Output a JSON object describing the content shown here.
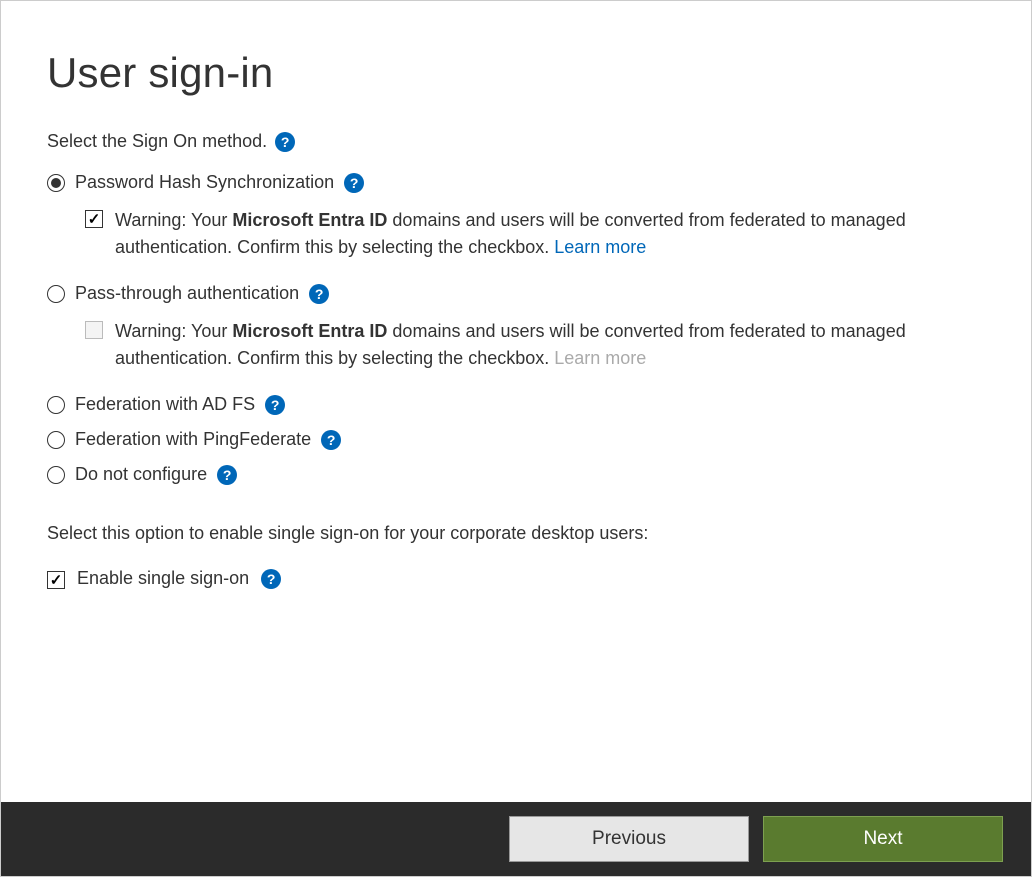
{
  "title": "User sign-in",
  "selectMethodLabel": "Select the Sign On method.",
  "options": {
    "passwordHash": {
      "label": "Password Hash Synchronization",
      "selected": true,
      "warningPrefix": "Warning: Your ",
      "warningBold": "Microsoft Entra ID",
      "warningSuffix": " domains and users will be converted from federated to managed authentication. Confirm this by selecting the checkbox. ",
      "learnMore": "Learn more",
      "checked": true
    },
    "passThrough": {
      "label": "Pass-through authentication",
      "selected": false,
      "warningPrefix": "Warning: Your ",
      "warningBold": "Microsoft Entra ID",
      "warningSuffix": " domains and users will be converted from federated to managed authentication. Confirm this by selecting the checkbox. ",
      "learnMore": "Learn more",
      "checked": false
    },
    "federationAdfs": {
      "label": "Federation with AD FS",
      "selected": false
    },
    "federationPing": {
      "label": "Federation with PingFederate",
      "selected": false
    },
    "doNotConfigure": {
      "label": "Do not configure",
      "selected": false
    }
  },
  "sso": {
    "description": "Select this option to enable single sign-on for your corporate desktop users:",
    "label": "Enable single sign-on",
    "checked": true
  },
  "buttons": {
    "previous": "Previous",
    "next": "Next"
  }
}
